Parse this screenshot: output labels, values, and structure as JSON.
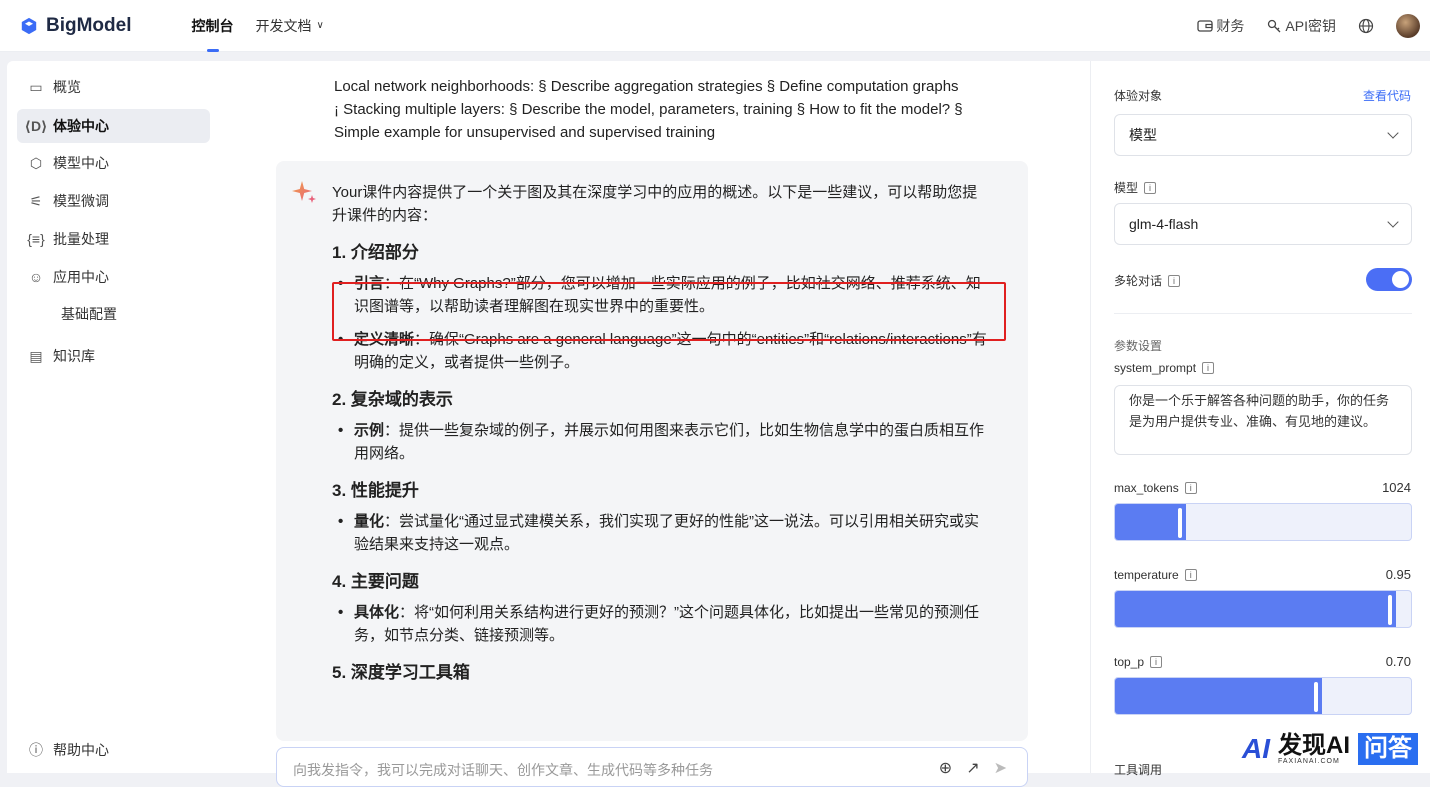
{
  "app": {
    "name": "BigModel"
  },
  "nav": {
    "tabs": [
      {
        "label": "控制台"
      },
      {
        "label": "开发文档"
      }
    ]
  },
  "top_right": {
    "finance": "财务",
    "api_key": "API密钥"
  },
  "sidebar": {
    "items": [
      {
        "label": "概览"
      },
      {
        "label": "体验中心"
      },
      {
        "label": "模型中心"
      },
      {
        "label": "模型微调"
      },
      {
        "label": "批量处理"
      },
      {
        "label": "应用中心"
      },
      {
        "label": "基础配置"
      },
      {
        "label": "知识库"
      }
    ],
    "help": "帮助中心"
  },
  "chat": {
    "prev_message": "Local network neighborhoods: § Describe aggregation strategies § Define computation graphs ¡ Stacking multiple layers: § Describe the model, parameters, training § How to fit the model? § Simple example for unsupervised and supervised training",
    "intro": "Your课件内容提供了一个关于图及其在深度学习中的应用的概述。以下是一些建议，可以帮助您提升课件的内容：",
    "sections": [
      {
        "title": "1. 介绍部分",
        "items": [
          {
            "key": "引言",
            "text": "：在“Why Graphs?”部分，您可以增加一些实际应用的例子，比如社交网络、推荐系统、知识图谱等，以帮助读者理解图在现实世界中的重要性。"
          },
          {
            "key": "定义清晰",
            "text": "：确保“Graphs are a general language”这一句中的“entities”和“relations/interactions”有明确的定义，或者提供一些例子。"
          }
        ]
      },
      {
        "title": "2. 复杂域的表示",
        "items": [
          {
            "key": "示例",
            "text": "：提供一些复杂域的例子，并展示如何用图来表示它们，比如生物信息学中的蛋白质相互作用网络。"
          }
        ]
      },
      {
        "title": "3. 性能提升",
        "items": [
          {
            "key": "量化",
            "text": "：尝试量化“通过显式建模关系，我们实现了更好的性能”这一说法。可以引用相关研究或实验结果来支持这一观点。"
          }
        ]
      },
      {
        "title": "4. 主要问题",
        "items": [
          {
            "key": "具体化",
            "text": "：将“如何利用关系结构进行更好的预测？”这个问题具体化，比如提出一些常见的预测任务，如节点分类、链接预测等。"
          }
        ]
      },
      {
        "title": "5. 深度学习工具箱",
        "items": []
      }
    ],
    "input_placeholder": "向我发指令，我可以完成对话聊天、创作文章、生成代码等多种任务"
  },
  "panel": {
    "target_label": "体验对象",
    "view_code": "查看代码",
    "target_value": "模型",
    "model_label": "模型",
    "model_value": "glm-4-flash",
    "multi_turn_label": "多轮对话",
    "multi_turn_on": true,
    "params_label": "参数设置",
    "system_prompt_label": "system_prompt",
    "system_prompt_value": "你是一个乐于解答各种问题的助手，你的任务是为用户提供专业、准确、有见地的建议。",
    "max_tokens_label": "max_tokens",
    "max_tokens_value": "1024",
    "max_tokens_fraction": 0.24,
    "temperature_label": "temperature",
    "temperature_value": "0.95",
    "temperature_fraction": 0.95,
    "top_p_label": "top_p",
    "top_p_value": "0.70",
    "top_p_fraction": 0.7,
    "tools_label": "工具调用"
  },
  "watermark": {
    "ai": "AI",
    "text": "发现AI",
    "sub": "FAXIANAI.COM",
    "badge": "问答"
  },
  "colors": {
    "accent": "#4b6ef5",
    "highlight_border": "#e02020"
  }
}
